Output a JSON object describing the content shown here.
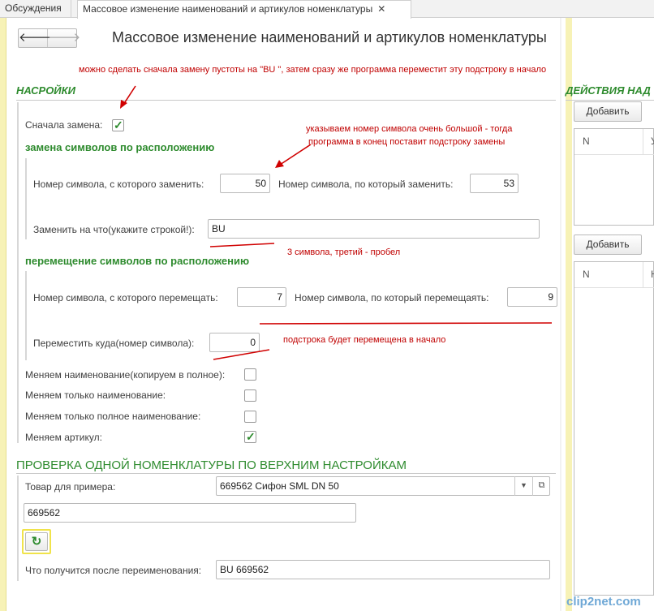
{
  "tabs": [
    {
      "label": "Обсуждения"
    },
    {
      "label": "Массовое изменение наименований и артикулов номенклатуры"
    }
  ],
  "form_title": "Массовое изменение наименований и артикулов номенклатуры",
  "notes": {
    "top": "можно сделать сначала замену пустоты на \"BU \", затем сразу же программа переместит эту подстроку в начало",
    "symbol_number_1": "указываем номер символа очень большой - тогда",
    "symbol_number_2": "программа в конец поставит подстроку замены",
    "three_symbols": "3 символа, третий - пробел",
    "moved_start": "подстрока будет перемещена в начало"
  },
  "settings": {
    "header": "НАСРОЙКИ",
    "first_replace_label": "Сначала замена:",
    "first_replace_checked": true,
    "replace_group_title": "замена символов по расположению",
    "from_symbol_label": "Номер символа, с которого заменить:",
    "from_symbol_value": "50",
    "to_symbol_label": "Номер символа, по который заменить:",
    "to_symbol_value": "53",
    "replace_with_label": "Заменить на что(укажите строкой!):",
    "replace_with_value": "BU",
    "move_group_title": "перемещение символов по расположению",
    "move_from_label": "Номер символа, с которого перемещать:",
    "move_from_value": "7",
    "move_to_label": "Номер символа, по который перемещаять:",
    "move_to_value": "9",
    "move_where_label": "Переместить куда(номер символа):",
    "move_where_value": "0",
    "change_name_copy_label": "Меняем наименование(копируем в полное):",
    "change_name_copy_checked": false,
    "change_name_only_label": "Меняем только наименование:",
    "change_name_only_checked": false,
    "change_full_name_label": "Меняем только полное наименование:",
    "change_full_name_checked": false,
    "change_article_label": "Меняем артикул:",
    "change_article_checked": true
  },
  "check": {
    "header": "ПРОВЕРКА ОДНОЙ НОМЕНКЛАТУРЫ ПО ВЕРХНИМ НАСТРОЙКАМ",
    "sample_label": "Товар для примера:",
    "sample_value": "669562 Сифон SML DN 50",
    "sample_code": "669562",
    "result_label": "Что получится после переименования:",
    "result_value": "BU 669562"
  },
  "actions": {
    "header": "ДЕЙСТВИЯ НАД",
    "add_label": "Добавить",
    "col_n": "N",
    "col_cut_1": "У",
    "col_cut_2": "Н"
  },
  "icons": {
    "back": "arrow-left-icon",
    "forward": "arrow-right-icon",
    "close": "close-icon",
    "checkmark": "checkmark-icon",
    "dropdown": "chevron-down-icon",
    "open": "open-form-icon",
    "refresh": "refresh-icon"
  },
  "colors": {
    "accent_green": "#2e8b2e",
    "annotation_red": "#c00000"
  },
  "watermark": "clip2net.com"
}
